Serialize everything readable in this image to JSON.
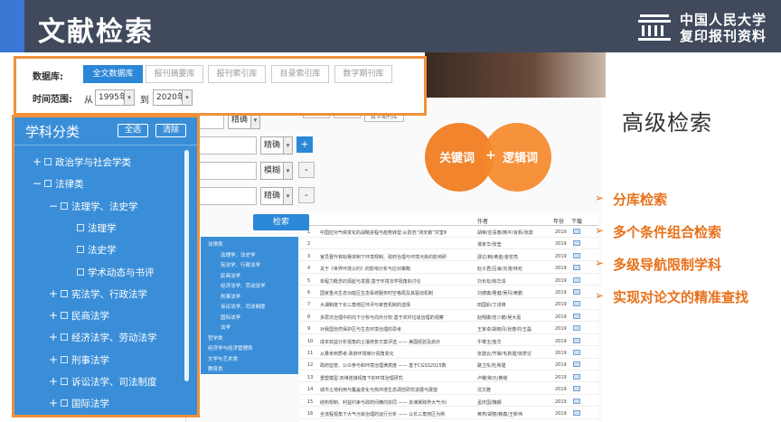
{
  "header": {
    "title": "文献检索",
    "brand_line1": "中国人民大学",
    "brand_line2": "复印报刊资料"
  },
  "search": {
    "database_label": "数据库:",
    "database_tabs": [
      "全文数据库",
      "报刊摘要库",
      "报刊索引库",
      "目录索引库",
      "数字期刊库"
    ],
    "time_label": "时间范围:",
    "from_label": "从",
    "from_year": "1995年",
    "to_label": "到",
    "to_year": "2020年",
    "match_options": [
      "精确",
      "精确",
      "模糊",
      "精确"
    ],
    "add_label": "+",
    "remove_label": "-",
    "search_button": "检索",
    "tag_labels": [
      "",
      "",
      "数字期刊库"
    ]
  },
  "subject": {
    "title": "学科分类",
    "select_all": "全选",
    "clear": "清除",
    "items": [
      {
        "toggle": "+",
        "label": "政治学与社会学类"
      },
      {
        "toggle": "−",
        "label": "法律类"
      },
      {
        "toggle": "−",
        "label": "法理学、法史学"
      },
      {
        "toggle": "",
        "label": "法理学"
      },
      {
        "toggle": "",
        "label": "法史学"
      },
      {
        "toggle": "",
        "label": "学术动态与书评"
      },
      {
        "toggle": "+",
        "label": "宪法学、行政法学"
      },
      {
        "toggle": "+",
        "label": "民商法学"
      },
      {
        "toggle": "+",
        "label": "经济法学、劳动法学"
      },
      {
        "toggle": "+",
        "label": "刑事法学"
      },
      {
        "toggle": "+",
        "label": "诉讼法学、司法制度"
      },
      {
        "toggle": "+",
        "label": "国际法学"
      }
    ]
  },
  "mini_tree": [
    "法律类",
    "法理学、法史学",
    "宪法学、行政法学",
    "民商法学",
    "经济法学、劳动法学",
    "刑事法学",
    "诉讼法学、司法制度",
    "国际法学",
    "法学",
    "哲学类",
    "经济学与经济管理类",
    "文学与艺术类",
    "教育类"
  ],
  "venn": {
    "left": "关键词",
    "plus": "+",
    "right": "逻辑词"
  },
  "advanced": {
    "title": "高级检索",
    "features": [
      "分库检索",
      "多个条件组合检索",
      "多级导航限制学科",
      "实现对论文的精准查找"
    ]
  },
  "results": {
    "headers": {
      "author": "作者",
      "year": "年份",
      "download": "下载"
    },
    "rows": [
      {
        "num": "1",
        "title": "中国应对气候变化的战略进程与趋势转型:从防范“测天鹅”灾害到适应“灰犀牛”风险",
        "author": "胡荣/应喜春/韩平/肖帆/张鼎",
        "year": "2019"
      },
      {
        "num": "2",
        "title": "",
        "author": "谭家华/张莹",
        "year": "2019"
      },
      {
        "num": "3",
        "title": "官员晋升锦标赛体制下环境规制、政府治理与环境污染的影响研究",
        "author": "邵达/韩/黄金/金宏亮",
        "year": "2019"
      },
      {
        "num": "4",
        "title": "关于《世界环境公约》的影响分析与应对策略",
        "author": "赵子君/吕海/刘涛/林屹",
        "year": "2019"
      },
      {
        "num": "5",
        "title": "单程力概念的源起与发展:基于环境法学视角的讨论",
        "author": "刘长松/徐华清",
        "year": "2019"
      },
      {
        "num": "6",
        "title": "国家重点生态功能区生态系统服务时空格局及其驱动机制",
        "author": "刘德庸/曹健/吴丹/黄鹏",
        "year": "2019"
      },
      {
        "num": "7",
        "title": "大湖制度下长三角地区环评与审查机制的选择",
        "author": "田国彩/丁进锋",
        "year": "2019"
      },
      {
        "num": "8",
        "title": "多层次治理中的向下分权与向外分权:基于农村垃圾治理的观察",
        "author": "赵翔康/曾少鹏/吴大嘉",
        "year": "2019"
      },
      {
        "num": "9",
        "title": "对我国自然保护区与生态环境治理的思考",
        "author": "王家卓/胡晓丹/张春洪/王磊",
        "year": "2019"
      },
      {
        "num": "10",
        "title": "成本效益分析视角的土壤修复方案评选 —— 美国经验及启示",
        "author": "牛琳玉/金华",
        "year": "2019"
      },
      {
        "num": "11",
        "title": "从量考到质考:政府环境审计视角变化",
        "author": "张建云/齐婵/毛新建/徐梦达",
        "year": "2019"
      },
      {
        "num": "12",
        "title": "政府监管、公众参与和环境治理满意度 —— 基于CGSS2015数据的实证研究",
        "author": "路卫东/杜希建",
        "year": "2019"
      },
      {
        "num": "13",
        "title": "重塑模型:双维连接视角下的环境治理研究",
        "author": "卢耀/和元/黄继",
        "year": "2019"
      },
      {
        "num": "14",
        "title": "城市土地利用与覆盖变化与热环境生态调控研究进展与展望",
        "author": "沈文雅",
        "year": "2019"
      },
      {
        "num": "15",
        "title": "结构规制、利益约束与政府间横向协同 —— 京津冀跨界大气污染联防联控的机制分析",
        "author": "孟庆国/魏娜",
        "year": "2019"
      },
      {
        "num": "16",
        "title": "全流程视角下大气污染治理的运行分析 —— 以长三角地区为例",
        "author": "黄燕/胡丽/韩鑫/王新伟",
        "year": "2019"
      }
    ]
  },
  "colors": {
    "orange": "#f0903a",
    "blue": "#2b87d8",
    "header_bg": "#404a5c"
  },
  "icons": {
    "brand_logo": "building-stripes-icon",
    "feature_bullet": "triangle-right-icon",
    "download": "download-icon"
  }
}
